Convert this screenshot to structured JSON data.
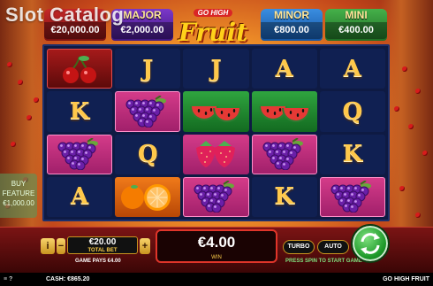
{
  "watermark": "Slot Catalog",
  "jackpots": {
    "grand": {
      "title": "",
      "value": "€20,000.00"
    },
    "major": {
      "title": "MAJOR",
      "value": "€2,000.00"
    },
    "minor": {
      "title": "MINOR",
      "value": "€800.00"
    },
    "mini": {
      "title": "MINI",
      "value": "€400.00"
    }
  },
  "logo": {
    "top": "GO HIGH",
    "main": "Fruit"
  },
  "reels": [
    [
      "cherry",
      "J",
      "J",
      "A",
      "A"
    ],
    [
      "K",
      "grapes",
      "watermelon",
      "watermelon",
      "Q"
    ],
    [
      "grapes",
      "Q",
      "strawberry",
      "grapes",
      "K"
    ],
    [
      "A",
      "orange",
      "grapes",
      "K",
      "grapes"
    ]
  ],
  "side_panel": {
    "line1": "BUY",
    "line2": "FEATURE",
    "line3": "€1,000.00"
  },
  "bet": {
    "value": "€20.00",
    "label": "TOTAL BET",
    "minus": "−",
    "plus": "+",
    "info": "i"
  },
  "game_pays": "GAME PAYS €4.00",
  "win": {
    "value": "€4.00",
    "label": "WIN"
  },
  "turbo": "TURBO",
  "auto": "AUTO",
  "press_spin": "PRESS SPIN TO START GAME",
  "footer": {
    "cash": "CASH: €865.20",
    "game_name": "GO HIGH FRUIT",
    "icons": "≡ ?"
  }
}
